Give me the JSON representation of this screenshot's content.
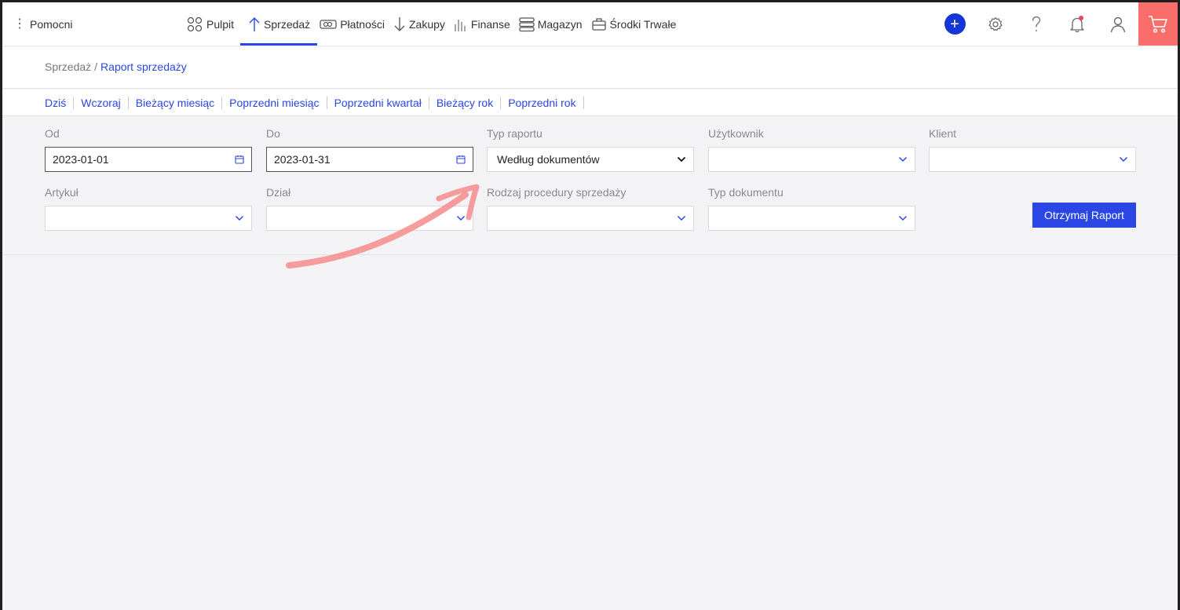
{
  "brand": {
    "label": "Pomocni"
  },
  "nav": [
    {
      "label": "Pulpit",
      "icon": "dashboard-icon"
    },
    {
      "label": "Sprzedaż",
      "icon": "arrow-up-icon",
      "active": true
    },
    {
      "label": "Płatności",
      "icon": "cash-icon"
    },
    {
      "label": "Zakupy",
      "icon": "arrow-down-icon"
    },
    {
      "label": "Finanse",
      "icon": "bar-chart-icon"
    },
    {
      "label": "Magazyn",
      "icon": "warehouse-icon"
    },
    {
      "label": "Środki Trwałe",
      "icon": "fixed-assets-icon"
    }
  ],
  "breadcrumb": {
    "parent": "Sprzedaż",
    "separator": "/",
    "current": "Raport sprzedaży"
  },
  "quick_ranges": [
    "Dziś",
    "Wczoraj",
    "Bieżący miesiąc",
    "Poprzedni miesiąc",
    "Poprzedni kwartał",
    "Bieżący rok",
    "Poprzedni rok"
  ],
  "filters": {
    "od": {
      "label": "Od",
      "value": "2023-01-01"
    },
    "do": {
      "label": "Do",
      "value": "2023-01-31"
    },
    "typ_raportu": {
      "label": "Typ raportu",
      "value": "Według dokumentów"
    },
    "uzytkownik": {
      "label": "Użytkownik",
      "value": ""
    },
    "klient": {
      "label": "Klient",
      "value": ""
    },
    "artykul": {
      "label": "Artykuł",
      "value": ""
    },
    "dzial": {
      "label": "Dział",
      "value": ""
    },
    "rodzaj": {
      "label": "Rodzaj procedury sprzedaży",
      "value": ""
    },
    "typ_dokumentu": {
      "label": "Typ dokumentu",
      "value": ""
    }
  },
  "report_button": {
    "label": "Otrzymaj Raport"
  },
  "colors": {
    "accent": "#2a47e6",
    "cart_bg": "#f96e6b",
    "plus_bg": "#1536d6",
    "annotation_arrow": "#f48b8b"
  }
}
